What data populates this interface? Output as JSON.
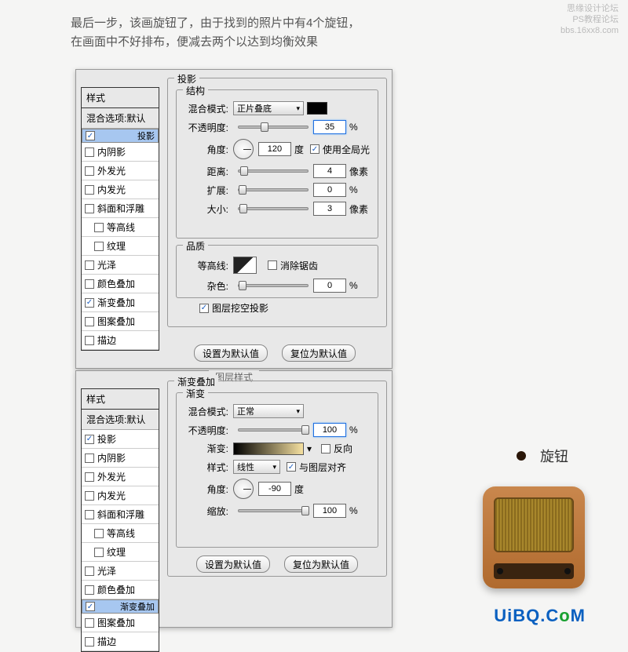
{
  "intro": {
    "line1": "最后一步，该画旋钮了，由于找到的照片中有4个旋钮，",
    "line2": "在画面中不好排布，便减去两个以达到均衡效果"
  },
  "watermark": {
    "l1": "思缘设计论坛",
    "l2": "PS教程论坛",
    "l3": "bbs.16xx8.com"
  },
  "d1": {
    "title": "",
    "styles_header": "样式",
    "blend_options": "混合选项:默认",
    "items": [
      {
        "label": "投影",
        "checked": true,
        "selected": true
      },
      {
        "label": "内阴影",
        "checked": false
      },
      {
        "label": "外发光",
        "checked": false
      },
      {
        "label": "内发光",
        "checked": false
      },
      {
        "label": "斜面和浮雕",
        "checked": false
      },
      {
        "label": "等高线",
        "checked": false,
        "indent": true
      },
      {
        "label": "纹理",
        "checked": false,
        "indent": true
      },
      {
        "label": "光泽",
        "checked": false
      },
      {
        "label": "颜色叠加",
        "checked": false
      },
      {
        "label": "渐变叠加",
        "checked": true
      },
      {
        "label": "图案叠加",
        "checked": false
      },
      {
        "label": "描边",
        "checked": false
      }
    ],
    "shadow": {
      "group_title": "投影",
      "struct_title": "结构",
      "blend_mode_lbl": "混合模式:",
      "blend_mode_val": "正片叠底",
      "swatch": "#000000",
      "opacity_lbl": "不透明度:",
      "opacity_val": "35",
      "opacity_unit": "%",
      "angle_lbl": "角度:",
      "angle_val": "120",
      "angle_unit": "度",
      "use_global_lbl": "使用全局光",
      "use_global_checked": true,
      "distance_lbl": "距离:",
      "distance_val": "4",
      "distance_unit": "像素",
      "spread_lbl": "扩展:",
      "spread_val": "0",
      "spread_unit": "%",
      "size_lbl": "大小:",
      "size_val": "3",
      "size_unit": "像素",
      "quality_title": "品质",
      "contour_lbl": "等高线:",
      "antialias_lbl": "消除锯齿",
      "antialias_checked": false,
      "noise_lbl": "杂色:",
      "noise_val": "0",
      "noise_unit": "%",
      "knockout_lbl": "图层挖空投影",
      "knockout_checked": true,
      "btn_default": "设置为默认值",
      "btn_reset": "复位为默认值"
    }
  },
  "d2": {
    "title": "图层样式",
    "styles_header": "样式",
    "blend_options": "混合选项:默认",
    "items": [
      {
        "label": "投影",
        "checked": true
      },
      {
        "label": "内阴影",
        "checked": false
      },
      {
        "label": "外发光",
        "checked": false
      },
      {
        "label": "内发光",
        "checked": false
      },
      {
        "label": "斜面和浮雕",
        "checked": false
      },
      {
        "label": "等高线",
        "checked": false,
        "indent": true
      },
      {
        "label": "纹理",
        "checked": false,
        "indent": true
      },
      {
        "label": "光泽",
        "checked": false
      },
      {
        "label": "颜色叠加",
        "checked": false
      },
      {
        "label": "渐变叠加",
        "checked": true,
        "selected": true
      },
      {
        "label": "图案叠加",
        "checked": false
      },
      {
        "label": "描边",
        "checked": false
      }
    ],
    "grad": {
      "group_title": "渐变叠加",
      "sub_title": "渐变",
      "blend_mode_lbl": "混合模式:",
      "blend_mode_val": "正常",
      "opacity_lbl": "不透明度:",
      "opacity_val": "100",
      "opacity_unit": "%",
      "gradient_lbl": "渐变:",
      "reverse_lbl": "反向",
      "reverse_checked": false,
      "style_lbl": "样式:",
      "style_val": "线性",
      "align_lbl": "与图层对齐",
      "align_checked": true,
      "angle_lbl": "角度:",
      "angle_val": "-90",
      "angle_unit": "度",
      "scale_lbl": "缩放:",
      "scale_val": "100",
      "scale_unit": "%",
      "btn_default": "设置为默认值",
      "btn_reset": "复位为默认值"
    }
  },
  "knob_label": "旋钮",
  "brand": {
    "part1": "UiBQ.C",
    "part2": "o",
    "part3": "M"
  }
}
